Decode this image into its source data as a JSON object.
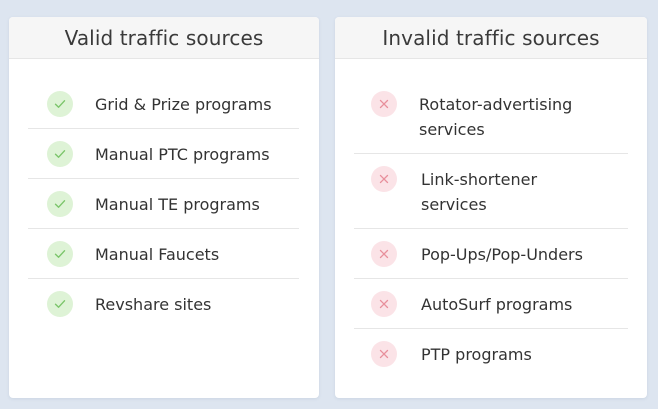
{
  "valid": {
    "title": "Valid traffic sources",
    "items": [
      {
        "label": "Grid & Prize programs",
        "icon": "check-icon"
      },
      {
        "label": "Manual PTC programs",
        "icon": "check-icon"
      },
      {
        "label": "Manual TE programs",
        "icon": "check-icon"
      },
      {
        "label": "Manual Faucets",
        "icon": "check-icon"
      },
      {
        "label": "Revshare sites",
        "icon": "check-icon"
      }
    ]
  },
  "invalid": {
    "title": "Invalid traffic sources",
    "items": [
      {
        "label": "Rotator-advertising services",
        "icon": "cross-icon"
      },
      {
        "label": "Link-shortener services",
        "icon": "cross-icon"
      },
      {
        "label": "Pop-Ups/Pop-Unders",
        "icon": "cross-icon"
      },
      {
        "label": "AutoSurf programs",
        "icon": "cross-icon"
      },
      {
        "label": "PTP programs",
        "icon": "cross-icon"
      }
    ]
  },
  "colors": {
    "background": "#dde5f0",
    "check_badge": "#def3d6",
    "check_mark": "#7bc56a",
    "cross_badge": "#fbe3e7",
    "cross_mark": "#e8909c"
  }
}
